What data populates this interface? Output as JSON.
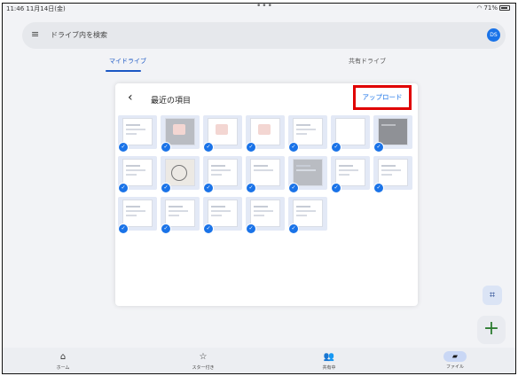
{
  "status": {
    "time": "11:46  11月14日(金)",
    "dots": "•••",
    "battery": "71%"
  },
  "search": {
    "placeholder": "ドライブ内を検索",
    "avatar": "DS"
  },
  "tabs": [
    {
      "label": "マイドライブ",
      "active": true
    },
    {
      "label": "共有ドライブ",
      "active": false
    }
  ],
  "modal": {
    "back": "‹",
    "title": "最近の項目",
    "upload_label": "アップロード"
  },
  "thumbnails_selected": 20,
  "thumbnails_total": 20,
  "bottom_nav": [
    {
      "label": "ホーム",
      "icon": "home-icon",
      "glyph": "⌂"
    },
    {
      "label": "スター付き",
      "icon": "star-icon",
      "glyph": "☆"
    },
    {
      "label": "共有中",
      "icon": "people-icon",
      "glyph": "👥"
    },
    {
      "label": "ファイル",
      "icon": "folder-icon",
      "glyph": "▰",
      "active": true
    }
  ],
  "colors": {
    "accent": "#1a73e8",
    "highlight": "#e00000",
    "fab_plus": "#2e7d32"
  }
}
